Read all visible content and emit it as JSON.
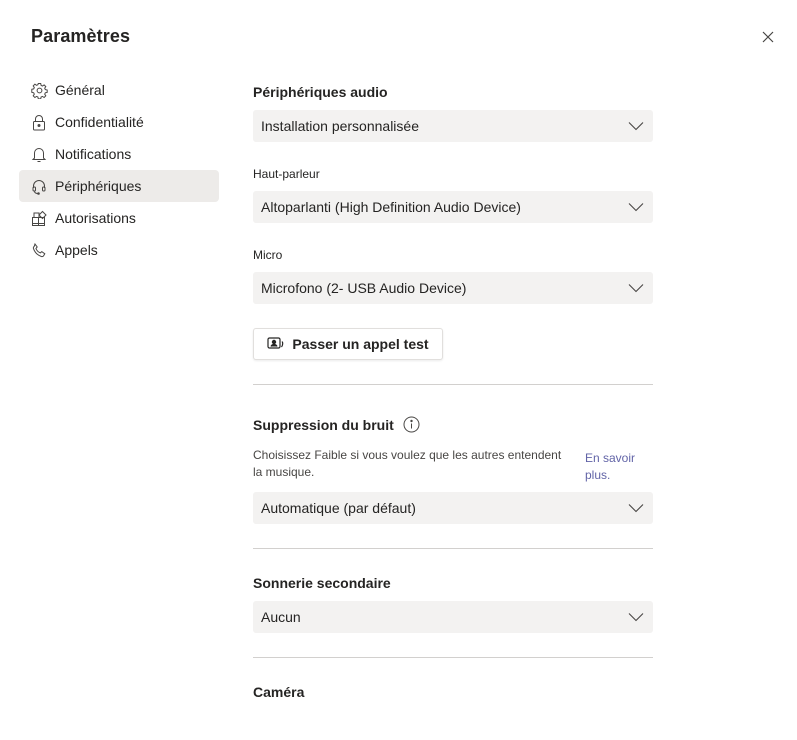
{
  "dialog": {
    "title": "Paramètres",
    "close_icon": "close-icon"
  },
  "sidebar": {
    "items": [
      {
        "label": "Général",
        "icon": "gear-icon",
        "active": false
      },
      {
        "label": "Confidentialité",
        "icon": "lock-icon",
        "active": false
      },
      {
        "label": "Notifications",
        "icon": "bell-icon",
        "active": false
      },
      {
        "label": "Périphériques",
        "icon": "headset-icon",
        "active": true
      },
      {
        "label": "Autorisations",
        "icon": "apps-icon",
        "active": false
      },
      {
        "label": "Appels",
        "icon": "phone-icon",
        "active": false
      }
    ]
  },
  "audio": {
    "title": "Périphériques audio",
    "device_setup": {
      "value": "Installation personnalisée"
    },
    "speaker": {
      "label": "Haut-parleur",
      "value": "Altoparlanti (High Definition Audio Device)"
    },
    "microphone": {
      "label": "Micro",
      "value": "Microfono (2- USB Audio Device)"
    },
    "test_call_button": "Passer un appel test"
  },
  "noise_suppression": {
    "title": "Suppression du bruit",
    "description": "Choisissez Faible si vous voulez que les autres entendent la musique.",
    "learn_more": "En savoir plus.",
    "value": "Automatique (par défaut)"
  },
  "secondary_ringer": {
    "title": "Sonnerie secondaire",
    "value": "Aucun"
  },
  "camera": {
    "title": "Caméra"
  },
  "colors": {
    "accent": "#6264a7",
    "select_bg": "#f3f2f1",
    "active_nav_bg": "#edebe9",
    "divider": "#d2d0ce"
  }
}
